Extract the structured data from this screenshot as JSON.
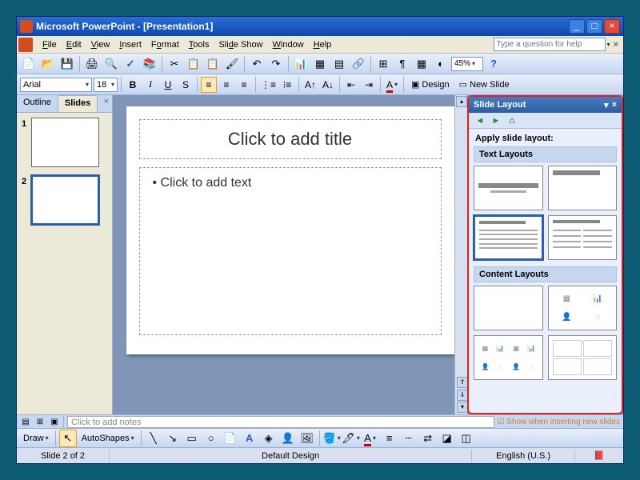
{
  "titlebar": {
    "title": "Microsoft PowerPoint - [Presentation1]"
  },
  "menus": {
    "file": "File",
    "edit": "Edit",
    "view": "View",
    "insert": "Insert",
    "format": "Format",
    "tools": "Tools",
    "slideshow": "Slide Show",
    "window": "Window",
    "help": "Help"
  },
  "helpbox_placeholder": "Type a question for help",
  "zoom": "45%",
  "font": {
    "name": "Arial",
    "size": "18"
  },
  "format_buttons": {
    "bold": "B",
    "italic": "I",
    "underline": "U",
    "shadow": "S"
  },
  "design_label": "Design",
  "newslide_label": "New Slide",
  "tabs": {
    "outline": "Outline",
    "slides": "Slides"
  },
  "thumbs": [
    {
      "num": "1"
    },
    {
      "num": "2"
    }
  ],
  "slide": {
    "title_placeholder": "Click to add title",
    "body_placeholder": "Click to add text"
  },
  "taskpane": {
    "title": "Slide Layout",
    "apply_label": "Apply slide layout:",
    "section_text": "Text Layouts",
    "section_content": "Content Layouts",
    "show_checkbox": "Show when inserting new slides"
  },
  "notes_placeholder": "Click to add notes",
  "drawbar": {
    "draw": "Draw",
    "autoshapes": "AutoShapes"
  },
  "status": {
    "slide": "Slide 2 of 2",
    "design": "Default Design",
    "lang": "English (U.S.)"
  }
}
